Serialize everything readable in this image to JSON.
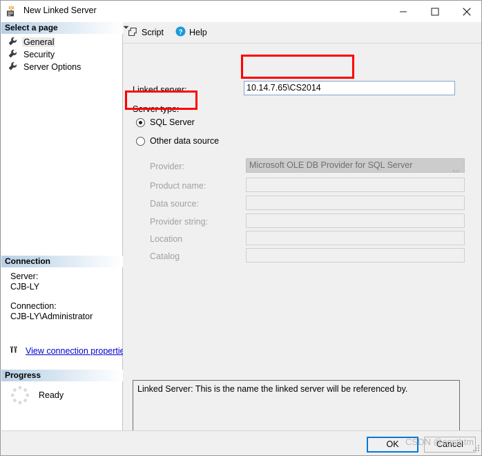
{
  "window": {
    "title": "New Linked Server",
    "icon": "linked-server-icon",
    "controls": {
      "minimize": "–",
      "maximize": "□",
      "close": "✕"
    }
  },
  "sidebar": {
    "select_page_header": "Select a page",
    "pages": [
      {
        "label": "General",
        "icon": "wrench-icon",
        "selected": true
      },
      {
        "label": "Security",
        "icon": "wrench-icon",
        "selected": false
      },
      {
        "label": "Server Options",
        "icon": "wrench-icon",
        "selected": false
      }
    ],
    "connection_header": "Connection",
    "connection": {
      "server_label": "Server:",
      "server_value": "CJB-LY",
      "connection_label": "Connection:",
      "connection_value": "CJB-LY\\Administrator",
      "view_properties_link": "View connection properties",
      "view_properties_icon": "connection-properties-icon"
    },
    "progress_header": "Progress",
    "progress": {
      "status": "Ready",
      "spinner_icon": "loading-spinner-icon"
    }
  },
  "toolbar": {
    "script_label": "Script",
    "script_icon": "script-icon",
    "dropdown_icon": "chevron-down-icon",
    "help_label": "Help",
    "help_icon": "help-circle-icon"
  },
  "form": {
    "linked_server_label": "Linked server:",
    "linked_server_value": "10.14.7.65\\CS2014",
    "server_type_label": "Server type:",
    "radio_sql_server": "SQL Server",
    "radio_other_data_source": "Other data source",
    "selected_server_type": "SQL Server",
    "provider_label": "Provider:",
    "provider_value": "Microsoft OLE DB Provider for SQL Server",
    "product_name_label": "Product name:",
    "product_name_value": "",
    "data_source_label": "Data source:",
    "data_source_value": "",
    "provider_string_label": "Provider string:",
    "provider_string_value": "",
    "location_label": "Location",
    "location_value": "",
    "catalog_label": "Catalog",
    "catalog_value": "",
    "help_text": "Linked Server: This is the name the linked server will be referenced by."
  },
  "footer": {
    "ok_label": "OK",
    "cancel_label": "Cancel"
  },
  "overlay": {
    "watermark": "CSDN @cgsthtm",
    "highlight_color": "#ff0000",
    "accent_color": "#0078d7",
    "link_color": "#0000cc"
  }
}
